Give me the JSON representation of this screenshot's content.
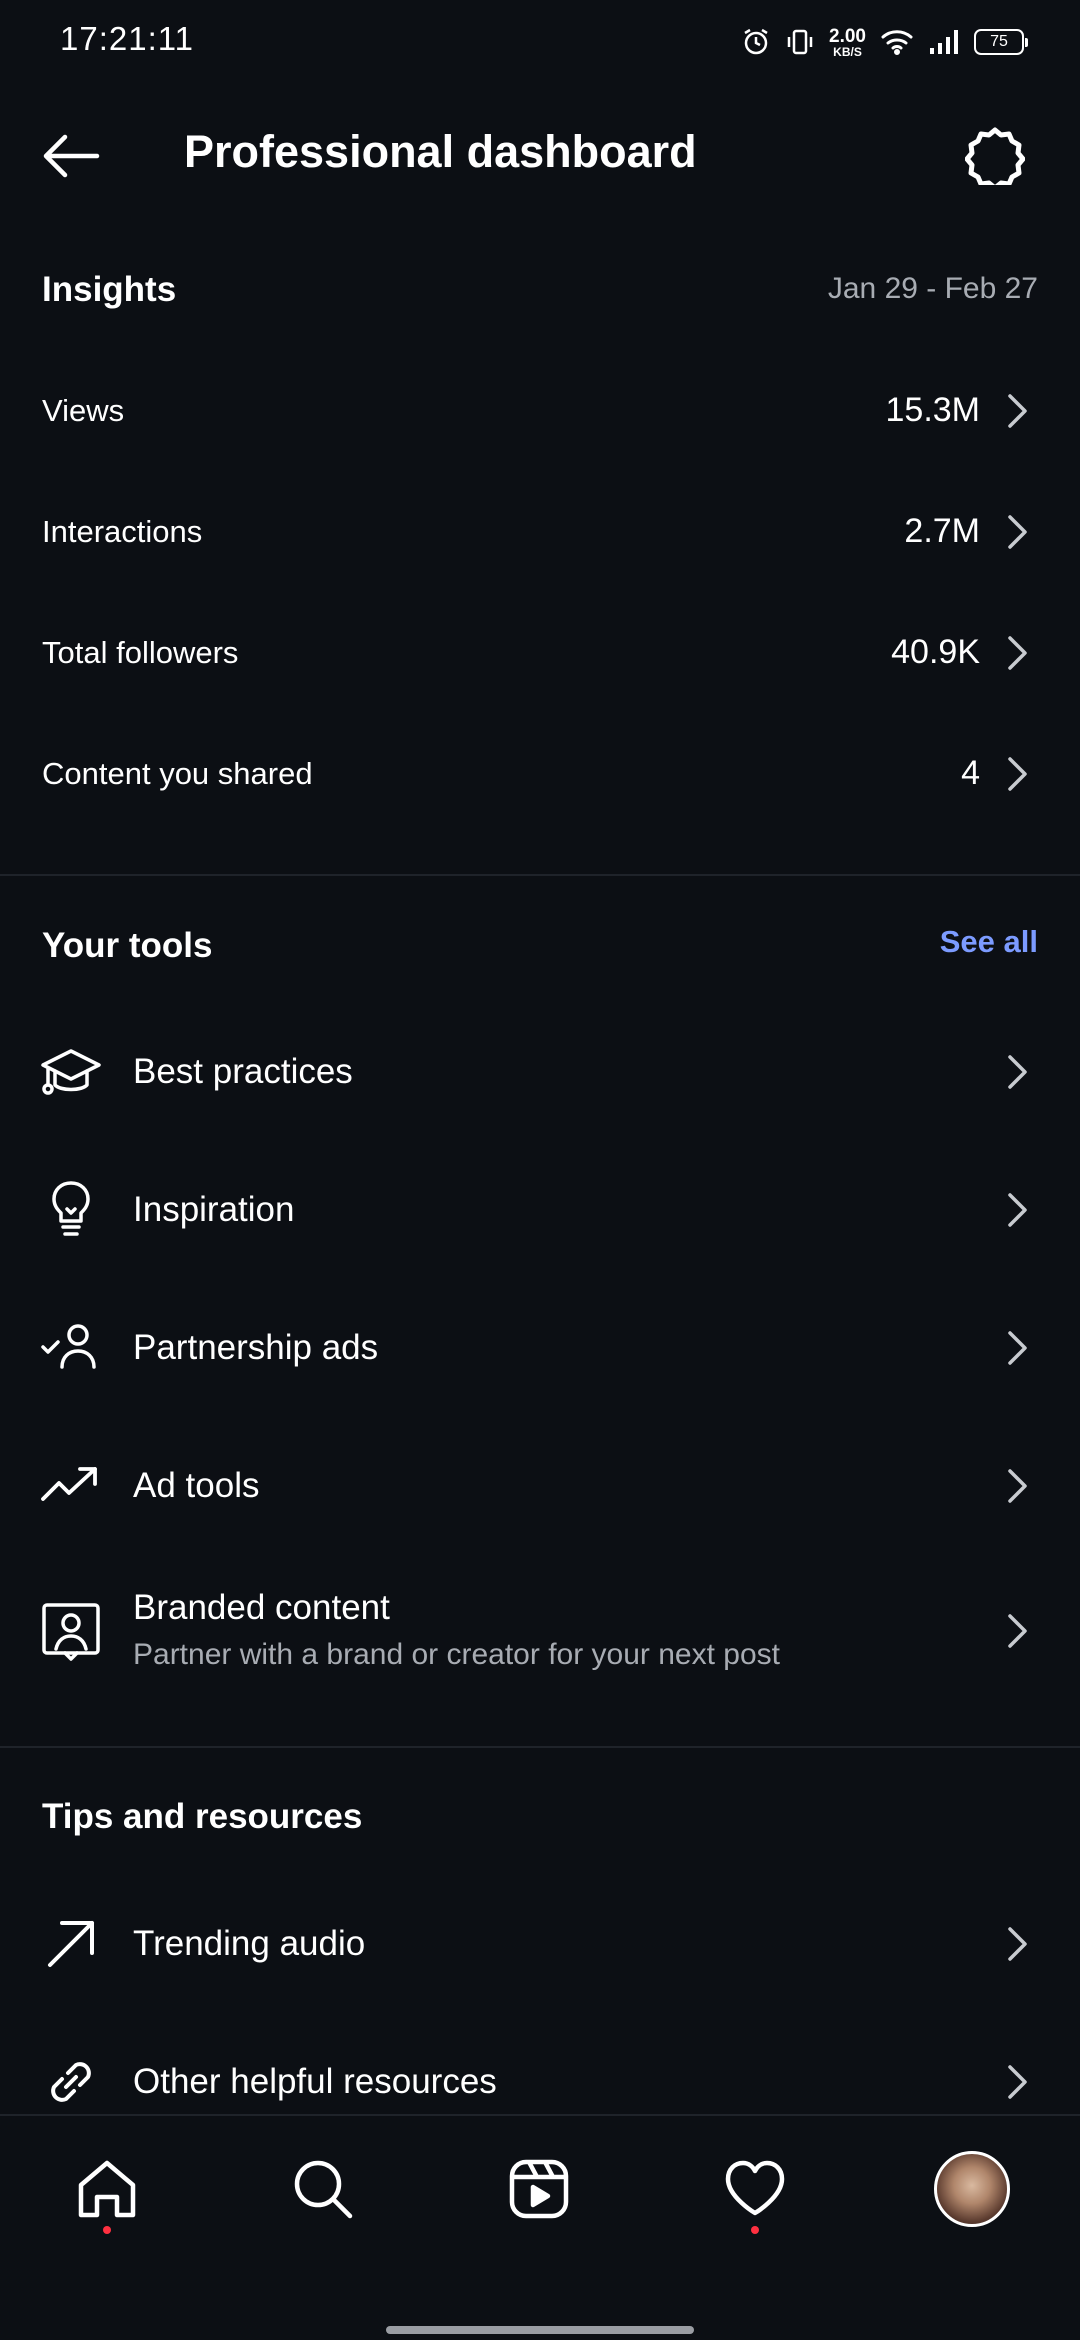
{
  "status_bar": {
    "time": "17:21:11",
    "net_speed_value": "2.00",
    "net_speed_unit": "KB/S",
    "battery": "75",
    "icons": [
      "alarm-icon",
      "vibrate-icon",
      "wifi-icon",
      "signal-icon",
      "battery-icon"
    ]
  },
  "header": {
    "title": "Professional dashboard",
    "back_icon": "arrow-left-icon",
    "settings_icon": "gear-icon"
  },
  "insights": {
    "title": "Insights",
    "date_range": "Jan 29 - Feb 27",
    "rows": [
      {
        "label": "Views",
        "value": "15.3M"
      },
      {
        "label": "Interactions",
        "value": "2.7M"
      },
      {
        "label": "Total followers",
        "value": "40.9K"
      },
      {
        "label": "Content you shared",
        "value": "4"
      }
    ]
  },
  "tools": {
    "title": "Your tools",
    "see_all": "See all",
    "items": [
      {
        "label": "Best practices",
        "icon": "graduation-cap-icon"
      },
      {
        "label": "Inspiration",
        "icon": "lightbulb-icon"
      },
      {
        "label": "Partnership ads",
        "icon": "person-check-icon"
      },
      {
        "label": "Ad tools",
        "icon": "trending-up-icon"
      },
      {
        "label": "Branded content",
        "sublabel": "Partner with a brand or creator for your next post",
        "icon": "branded-content-icon"
      }
    ]
  },
  "tips": {
    "title": "Tips and resources",
    "items": [
      {
        "label": "Trending audio",
        "icon": "arrow-up-right-icon"
      },
      {
        "label": "Other helpful resources",
        "icon": "link-icon"
      }
    ]
  },
  "bottom_nav": {
    "items": [
      "home-icon",
      "search-icon",
      "reels-icon",
      "heart-icon",
      "avatar"
    ]
  },
  "colors": {
    "background": "#0c0f14",
    "accent_link": "#7c9bff",
    "secondary_text": "#a8acb3",
    "notification_dot": "#ff3040"
  }
}
